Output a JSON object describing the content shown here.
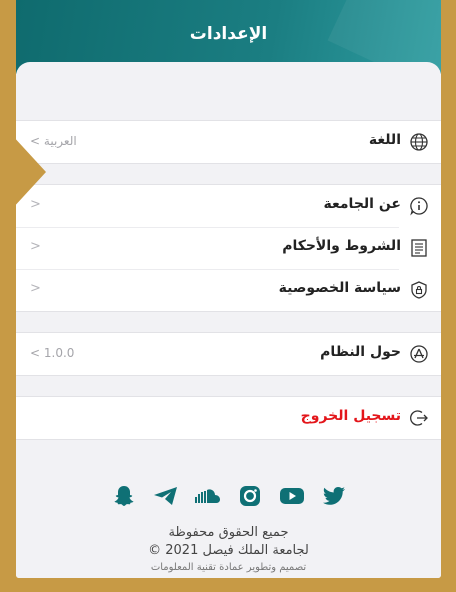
{
  "header": {
    "title": "الإعدادات"
  },
  "language": {
    "label": "اللغة",
    "value": "العربية",
    "chevron": "<"
  },
  "info_rows": [
    {
      "label": "عن الجامعة",
      "chevron": "<",
      "icon": "info-icon"
    },
    {
      "label": "الشروط والأحكام",
      "chevron": "<",
      "icon": "document-icon"
    },
    {
      "label": "سياسة الخصوصية",
      "chevron": "<",
      "icon": "shield-lock-icon"
    }
  ],
  "system": {
    "label": "حول النظام",
    "value": "1.0.0",
    "chevron": "<",
    "icon": "appstore-icon"
  },
  "logout": {
    "label": "تسجيل الخروج",
    "icon": "logout-icon"
  },
  "social": [
    "snapchat-icon",
    "telegram-icon",
    "soundcloud-icon",
    "instagram-icon",
    "youtube-icon",
    "twitter-icon"
  ],
  "footer": {
    "line1": "جميع الحقوق محفوظة",
    "line2": "لجامعة الملك فيصل 2021 ©",
    "line3": "تصميم وتطوير عمادة تقنية المعلومات"
  },
  "colors": {
    "header": "#137378",
    "accent": "#0f7075",
    "logout": "#e3161b",
    "frame": "#c79a45"
  }
}
